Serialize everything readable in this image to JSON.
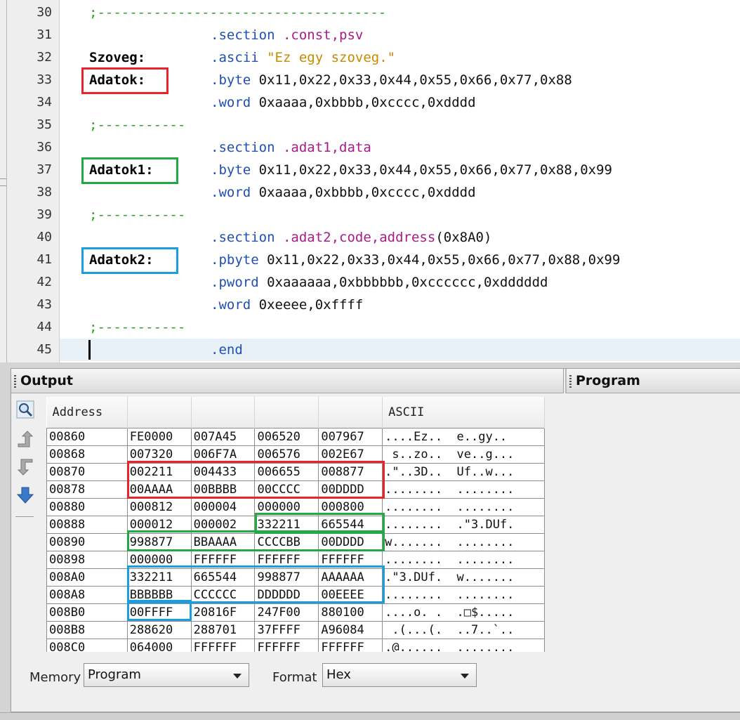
{
  "editor": {
    "lines": [
      {
        "n": "30",
        "comment": ";------------------------------------"
      },
      {
        "n": "31",
        "dir": ".section",
        "args": [
          {
            "t": ".const,psv",
            "c": "sym"
          }
        ]
      },
      {
        "n": "32",
        "label": "Szoveg:",
        "dir": ".ascii",
        "args": [
          {
            "t": "\"Ez egy szoveg.\"",
            "c": "str"
          }
        ]
      },
      {
        "n": "33",
        "label": "Adatok:",
        "dir": ".byte",
        "args": [
          {
            "t": "0x11,0x22,0x33,0x44,0x55,0x66,0x77,0x88",
            "c": "num"
          }
        ]
      },
      {
        "n": "34",
        "dir": ".word",
        "args": [
          {
            "t": "0xaaaa,0xbbbb,0xcccc,0xdddd",
            "c": "num"
          }
        ]
      },
      {
        "n": "35",
        "comment": ";-----------"
      },
      {
        "n": "36",
        "dir": ".section",
        "args": [
          {
            "t": ".adat1,data",
            "c": "sym"
          }
        ]
      },
      {
        "n": "37",
        "label": "Adatok1:",
        "dir": ".byte",
        "args": [
          {
            "t": "0x11,0x22,0x33,0x44,0x55,0x66,0x77,0x88,0x99",
            "c": "num"
          }
        ]
      },
      {
        "n": "38",
        "dir": ".word",
        "args": [
          {
            "t": "0xaaaa,0xbbbb,0xcccc,0xdddd",
            "c": "num"
          }
        ]
      },
      {
        "n": "39",
        "comment": ";-----------"
      },
      {
        "n": "40",
        "dir": ".section",
        "args": [
          {
            "t": ".adat2,code,address",
            "c": "sym"
          },
          {
            "t": "(0x8A0)",
            "c": "num"
          }
        ]
      },
      {
        "n": "41",
        "label": "Adatok2:",
        "dir": ".pbyte",
        "args": [
          {
            "t": "0x11,0x22,0x33,0x44,0x55,0x66,0x77,0x88,0x99",
            "c": "num"
          }
        ]
      },
      {
        "n": "42",
        "dir": ".pword",
        "args": [
          {
            "t": "0xaaaaaa,0xbbbbbb,0xcccccc,0xdddddd",
            "c": "num"
          }
        ]
      },
      {
        "n": "43",
        "dir": ".word",
        "args": [
          {
            "t": "0xeeee,0xffff",
            "c": "num"
          }
        ]
      },
      {
        "n": "44",
        "comment": ";-----------"
      },
      {
        "n": "45",
        "dir": ".end",
        "args": [],
        "current": true
      }
    ],
    "highlight_colors": {
      "red": "#e8242a",
      "green": "#22a844",
      "blue": "#1a9ee0"
    }
  },
  "output_panel": {
    "title": "Output",
    "tools": [
      "search-icon",
      "step-over-icon",
      "step-back-icon",
      "download-arrow-icon"
    ],
    "table": {
      "headers": [
        "Address",
        "",
        "",
        "",
        "",
        "ASCII"
      ],
      "rows": [
        [
          "00860",
          "FE0000",
          "007A45",
          "006520",
          "007967",
          "....Ez..  e..gy.."
        ],
        [
          "00868",
          "007320",
          "006F7A",
          "006576",
          "002E67",
          " s..zo..  ve..g..."
        ],
        [
          "00870",
          "002211",
          "004433",
          "006655",
          "008877",
          ".\"..3D..  Uf..w..."
        ],
        [
          "00878",
          "00AAAA",
          "00BBBB",
          "00CCCC",
          "00DDDD",
          "........  ........"
        ],
        [
          "00880",
          "000812",
          "000004",
          "000000",
          "000800",
          "........  ........"
        ],
        [
          "00888",
          "000012",
          "000002",
          "332211",
          "665544",
          "........  .\"3.DUf."
        ],
        [
          "00890",
          "998877",
          "BBAAAA",
          "CCCCBB",
          "00DDDD",
          "w.......  ........"
        ],
        [
          "00898",
          "000000",
          "FFFFFF",
          "FFFFFF",
          "FFFFFF",
          "........  ........"
        ],
        [
          "008A0",
          "332211",
          "665544",
          "998877",
          "AAAAAA",
          ".\"3.DUf.  w......."
        ],
        [
          "008A8",
          "BBBBBB",
          "CCCCCC",
          "DDDDDD",
          "00EEEE",
          "........  ........"
        ],
        [
          "008B0",
          "00FFFF",
          "20816F",
          "247F00",
          "880100",
          "....o. .  .□$....."
        ],
        [
          "008B8",
          "288620",
          "288701",
          "37FFFF",
          "A96084",
          " .(...(.  ..7..`.."
        ],
        [
          "008C0",
          "064000",
          "FFFFFF",
          "FFFFFF",
          "FFFFFF",
          ".@......  ........"
        ]
      ]
    },
    "memory_label": "Memory",
    "memory_value": "Program",
    "format_label": "Format",
    "format_value": "Hex"
  },
  "program_panel": {
    "title": "Program"
  }
}
